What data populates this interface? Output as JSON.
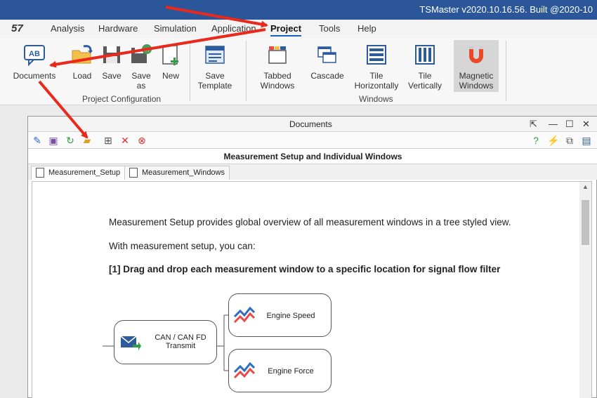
{
  "titlebar": {
    "title": "TSMaster v2020.10.16.56. Built @2020-10"
  },
  "menu": {
    "logo": "57",
    "items": [
      "Analysis",
      "Hardware",
      "Simulation",
      "Application",
      "Project",
      "Tools",
      "Help"
    ],
    "active": "Project"
  },
  "ribbon": {
    "buttons": {
      "documents": "Documents",
      "load": "Load",
      "save": "Save",
      "save_as_1": "Save",
      "save_as_2": "as",
      "new": "New",
      "save_template_1": "Save",
      "save_template_2": "Template",
      "tabbed_1": "Tabbed",
      "tabbed_2": "Windows",
      "cascade": "Cascade",
      "tile_h_1": "Tile",
      "tile_h_2": "Horizontally",
      "tile_v_1": "Tile",
      "tile_v_2": "Vertically",
      "magnetic_1": "Magnetic",
      "magnetic_2": "Windows"
    },
    "groups": {
      "project_config": "Project Configuration",
      "windows": "Windows"
    }
  },
  "documents_window": {
    "title": "Documents",
    "header": "Measurement Setup and Individual Windows",
    "tabs": [
      "Measurement_Setup",
      "Measurement_Windows"
    ],
    "active_tab": "Measurement_Setup",
    "content": {
      "line1": "Measurement Setup provides global overview of all measurement windows in a tree styled view.",
      "line2": "With measurement setup, you can:",
      "line3": "[1] Drag and drop each measurement window to a specific location for signal flow filter"
    },
    "diagram": {
      "source_1": "CAN / CAN FD",
      "source_2": "Transmit",
      "target_a": "Engine Speed",
      "target_b": "Engine Force"
    }
  },
  "colors": {
    "titlebar": "#2b579a",
    "accent": "#1a63c6",
    "arrow": "#e8291c"
  }
}
